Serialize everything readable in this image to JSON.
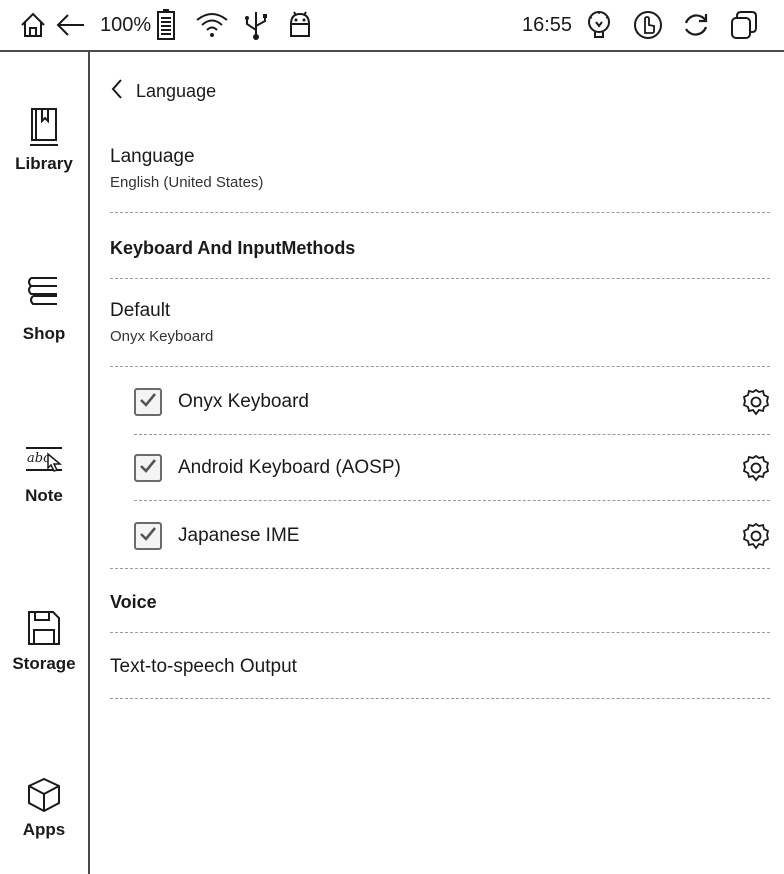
{
  "status_bar": {
    "battery": "100%",
    "time": "16:55",
    "icons": [
      "home-icon",
      "back-arrow-icon",
      "battery-icon",
      "wifi-icon",
      "usb-icon",
      "android-icon",
      "bulb-icon",
      "touch-icon",
      "refresh-icon",
      "window-icon"
    ]
  },
  "sidebar": {
    "items": [
      {
        "label": "Library",
        "icon": "book-icon"
      },
      {
        "label": "Shop",
        "icon": "books-stack-icon"
      },
      {
        "label": "Note",
        "icon": "note-pen-icon"
      },
      {
        "label": "Storage",
        "icon": "floppy-icon"
      },
      {
        "label": "Apps",
        "icon": "cube-icon"
      }
    ]
  },
  "page": {
    "back_title": "Language",
    "language": {
      "title": "Language",
      "value": "English (United States)"
    },
    "keyboard_section": "Keyboard And InputMethods",
    "default": {
      "title": "Default",
      "value": "Onyx Keyboard"
    },
    "keyboards": [
      {
        "label": "Onyx Keyboard",
        "checked": true
      },
      {
        "label": "Android Keyboard (AOSP)",
        "checked": true
      },
      {
        "label": "Japanese IME",
        "checked": true
      }
    ],
    "voice_section": "Voice",
    "tts": "Text-to-speech Output"
  }
}
